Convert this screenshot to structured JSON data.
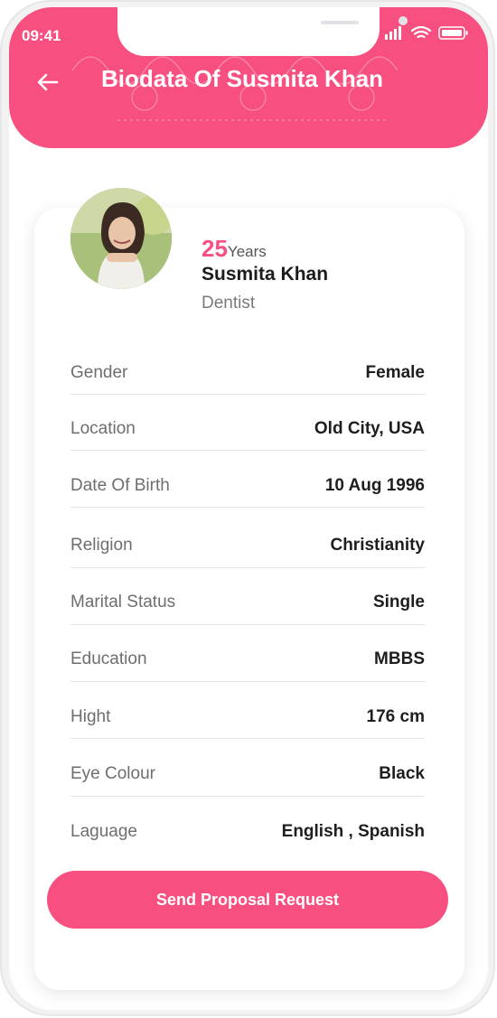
{
  "status_bar": {
    "time": "09:41"
  },
  "header": {
    "title": "Biodata Of Susmita Khan",
    "accent": "#f74f7f"
  },
  "profile": {
    "age": "25",
    "age_unit": "Years",
    "name": "Susmita Khan",
    "profession": "Dentist"
  },
  "details": [
    {
      "label": "Gender",
      "value": "Female"
    },
    {
      "label": "Location",
      "value": "Old City, USA"
    },
    {
      "label": "Date Of Birth",
      "value": "10 Aug 1996"
    },
    {
      "label": "Religion",
      "value": "Christianity"
    },
    {
      "label": "Marital Status",
      "value": "Single"
    },
    {
      "label": "Education",
      "value": "MBBS"
    },
    {
      "label": "Hight",
      "value": "176 cm"
    },
    {
      "label": "Eye Colour",
      "value": "Black"
    },
    {
      "label": "Laguage",
      "value": "English , Spanish"
    }
  ],
  "actions": {
    "send_proposal": "Send Proposal Request"
  },
  "icons": {
    "back": "arrow-left-icon",
    "signal": "signal-icon",
    "wifi": "wifi-icon",
    "battery": "battery-icon"
  }
}
